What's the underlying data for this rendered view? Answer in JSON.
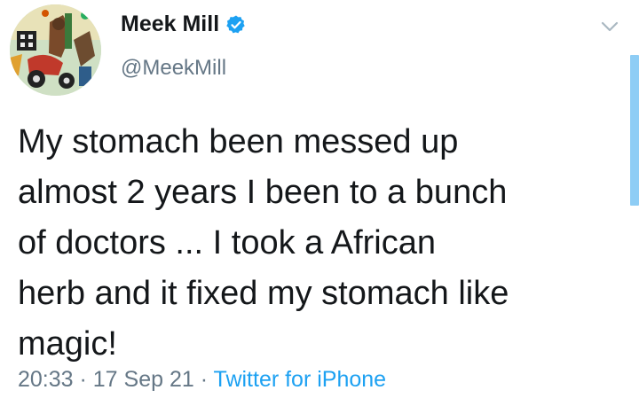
{
  "user": {
    "name": "Meek Mill",
    "handle": "@MeekMill",
    "verified": true,
    "avatar": "profile-avatar-artwork"
  },
  "tweet": {
    "text": "My stomach been messed up\nalmost 2 years I been to a bunch\nof doctors ... I took a African\nherb and it fixed my stomach like\nmagic!"
  },
  "meta": {
    "time": "20:33",
    "sep1": " · ",
    "date": "17 Sep 21",
    "sep2": " · ",
    "source": "Twitter for iPhone"
  },
  "icons": {
    "verified": "verified-badge-icon",
    "menu": "chevron-down-icon"
  },
  "colors": {
    "text": "#14171a",
    "secondary": "#657786",
    "accent": "#1da1f2"
  }
}
